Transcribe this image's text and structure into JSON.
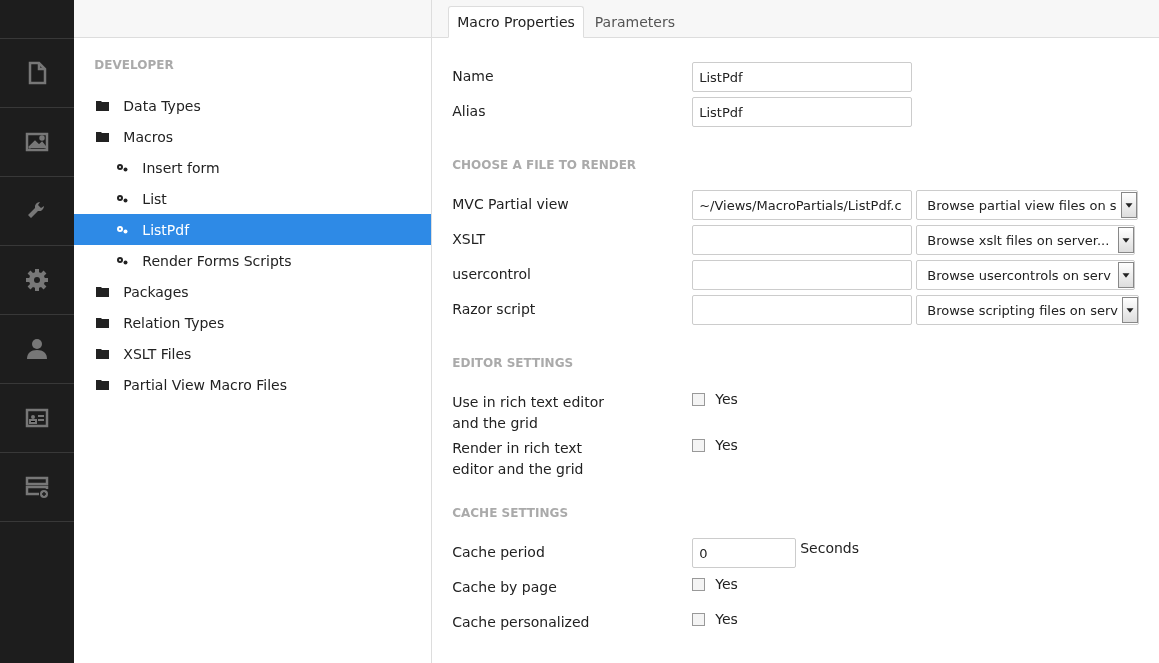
{
  "tree": {
    "heading": "DEVELOPER",
    "items": [
      {
        "label": "Data Types",
        "kind": "folder",
        "selected": false
      },
      {
        "label": "Macros",
        "kind": "folder",
        "selected": false,
        "children": [
          {
            "label": "Insert form",
            "kind": "macro",
            "selected": false
          },
          {
            "label": "List",
            "kind": "macro",
            "selected": false
          },
          {
            "label": "ListPdf",
            "kind": "macro",
            "selected": true
          },
          {
            "label": "Render Forms Scripts",
            "kind": "macro",
            "selected": false
          }
        ]
      },
      {
        "label": "Packages",
        "kind": "folder",
        "selected": false
      },
      {
        "label": "Relation Types",
        "kind": "folder",
        "selected": false
      },
      {
        "label": "XSLT Files",
        "kind": "folder",
        "selected": false
      },
      {
        "label": "Partial View Macro Files",
        "kind": "folder",
        "selected": false
      }
    ]
  },
  "tabs": [
    {
      "label": "Macro Properties",
      "selected": true
    },
    {
      "label": "Parameters",
      "selected": false
    }
  ],
  "sections": [
    {
      "rows": [
        {
          "kind": "text",
          "label": "Name",
          "value": "ListPdf"
        },
        {
          "kind": "text",
          "label": "Alias",
          "value": "ListPdf"
        }
      ]
    },
    {
      "heading": "CHOOSE A FILE TO RENDER",
      "rows": [
        {
          "kind": "file",
          "label": "MVC Partial view",
          "value": "~/Views/MacroPartials/ListPdf.c",
          "browse": "Browse partial view files on s"
        },
        {
          "kind": "file",
          "label": "XSLT",
          "browse": "Browse xslt files on server..."
        },
        {
          "kind": "file",
          "label": "usercontrol",
          "browse": "Browse usercontrols on serv"
        },
        {
          "kind": "file",
          "label": "Razor script",
          "browse": "Browse scripting files on serv"
        }
      ]
    },
    {
      "heading": "EDITOR SETTINGS",
      "rows": [
        {
          "kind": "checkbox",
          "label": "Use in rich text editor and the grid",
          "option": "Yes",
          "checked": false
        },
        {
          "kind": "checkbox",
          "label": "Render in rich text editor and the grid",
          "option": "Yes",
          "checked": false
        }
      ]
    },
    {
      "heading": "CACHE SETTINGS",
      "rows": [
        {
          "kind": "number",
          "label": "Cache period",
          "value": "0",
          "suffix": "Seconds"
        },
        {
          "kind": "checkbox",
          "label": "Cache by page",
          "option": "Yes",
          "checked": false
        },
        {
          "kind": "checkbox",
          "label": "Cache personalized",
          "option": "Yes",
          "checked": false
        }
      ]
    }
  ]
}
